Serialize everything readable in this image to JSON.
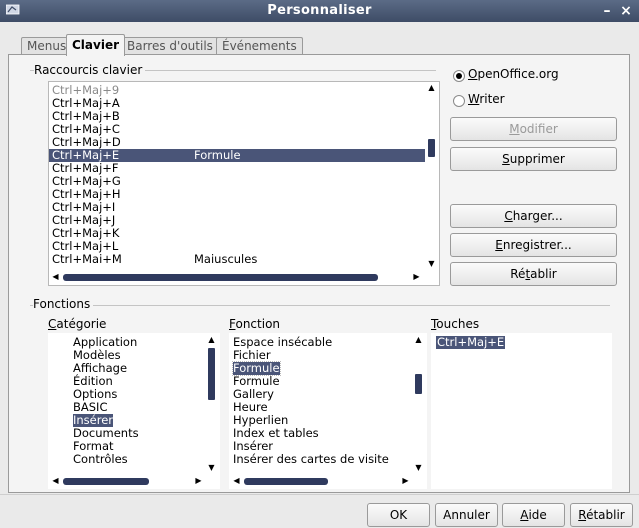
{
  "window": {
    "title": "Personnaliser",
    "minimize": "–",
    "close": "×"
  },
  "tabs": [
    {
      "label": "Menus",
      "active": false
    },
    {
      "label": "Clavier",
      "active": true
    },
    {
      "label": "Barres d'outils",
      "active": false
    },
    {
      "label": "Événements",
      "active": false
    }
  ],
  "shortcuts": {
    "group_label": "Raccourcis clavier",
    "rows": [
      {
        "key": "Ctrl+Maj+9",
        "fn": "",
        "dim": true
      },
      {
        "key": "Ctrl+Maj+A",
        "fn": ""
      },
      {
        "key": "Ctrl+Maj+B",
        "fn": ""
      },
      {
        "key": "Ctrl+Maj+C",
        "fn": ""
      },
      {
        "key": "Ctrl+Maj+D",
        "fn": ""
      },
      {
        "key": "Ctrl+Maj+E",
        "fn": "Formule",
        "selected": true
      },
      {
        "key": "Ctrl+Maj+F",
        "fn": ""
      },
      {
        "key": "Ctrl+Maj+G",
        "fn": ""
      },
      {
        "key": "Ctrl+Maj+H",
        "fn": ""
      },
      {
        "key": "Ctrl+Maj+I",
        "fn": ""
      },
      {
        "key": "Ctrl+Maj+J",
        "fn": ""
      },
      {
        "key": "Ctrl+Maj+K",
        "fn": ""
      },
      {
        "key": "Ctrl+Maj+L",
        "fn": ""
      },
      {
        "key": "Ctrl+Maj+M",
        "fn": "Majuscules"
      }
    ]
  },
  "scope": {
    "openoffice": {
      "label_u": "O",
      "label_rest": "penOffice.org",
      "checked": true
    },
    "writer": {
      "label_u": "W",
      "label_rest": "riter",
      "checked": false
    }
  },
  "right_buttons": {
    "modifier": {
      "pre": "",
      "u": "M",
      "post": "odifier"
    },
    "supprimer": {
      "pre": "",
      "u": "S",
      "post": "upprimer"
    },
    "charger": {
      "pre": "",
      "u": "C",
      "post": "harger..."
    },
    "enregistrer": {
      "pre": "",
      "u": "E",
      "post": "nregistrer..."
    },
    "retablir": {
      "pre": "Ré",
      "u": "t",
      "post": "ablir"
    }
  },
  "functions": {
    "group_label": "Fonctions",
    "categorie": {
      "label_u": "C",
      "label_rest": "atégorie",
      "items": [
        "Application",
        "Modèles",
        "Affichage",
        "Édition",
        "Options",
        "BASIC",
        "Insérer",
        "Documents",
        "Format",
        "Contrôles"
      ],
      "selected": "Insérer"
    },
    "fonction": {
      "label_u": "F",
      "label_rest": "onction",
      "items": [
        "Espace insécable",
        "Fichier",
        "Formule",
        "Formule",
        "Gallery",
        "Heure",
        "Hyperlien",
        "Index et tables",
        "Insérer",
        "Insérer des cartes de visite"
      ],
      "selected_index": 2
    },
    "touches": {
      "label_u": "T",
      "label_rest": "ouches",
      "items": [
        "Ctrl+Maj+E"
      ]
    }
  },
  "bottom_buttons": {
    "ok": "OK",
    "annuler": "Annuler",
    "aide": {
      "u": "A",
      "post": "ide"
    },
    "retablir": {
      "u": "R",
      "post": "établir"
    }
  }
}
